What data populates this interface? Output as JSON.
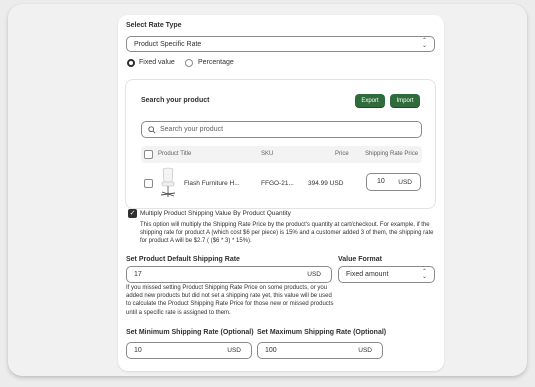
{
  "rate_type": {
    "heading": "Select Rate Type",
    "selected": "Product Specific Rate",
    "options": [
      {
        "label": "Fixed value",
        "selected": true
      },
      {
        "label": "Percentage",
        "selected": false
      }
    ]
  },
  "product_search": {
    "heading": "Search your product",
    "export_label": "Export",
    "import_label": "Import",
    "search_placeholder": "Search your product",
    "columns": [
      "Product Title",
      "SKU",
      "Price",
      "Shipping Rate Price"
    ],
    "rows": [
      {
        "title": "Flash Furniture H...",
        "sku": "FFGO-21...",
        "price": "394.99 USD",
        "rate_value": "10",
        "rate_unit": "USD"
      }
    ]
  },
  "multiply": {
    "checked": true,
    "label": "Multiply Product Shipping Value By Product Quantity",
    "help": "This option will multiply the Shipping Rate Price by the product's quantity at cart/checkout. For example, if the shipping rate for product A (which cost $6 per piece) is 15% and a customer added 3 of them, the shipping rate for product A will be $2.7 ( ($6 * 3) * 15%)."
  },
  "default_rate": {
    "label": "Set Product Default Shipping Rate",
    "value": "17",
    "unit": "USD",
    "help": "If you missed setting Product Shipping Rate Price on some products, or you added new products but did not set a shipping rate yet, this value will be used to calculate the Product Shipping Rate Price for those new or missed products until a specific rate is assigned to them."
  },
  "value_format": {
    "label": "Value Format",
    "selected": "Fixed amount"
  },
  "min_rate": {
    "label": "Set Minimum Shipping Rate (Optional)",
    "value": "10",
    "unit": "USD"
  },
  "max_rate": {
    "label": "Set Maximum Shipping Rate (Optional)",
    "value": "100",
    "unit": "USD"
  },
  "colors": {
    "accent_green": "#2f6b3b",
    "text": "#303030",
    "border": "#8a8a8a"
  }
}
